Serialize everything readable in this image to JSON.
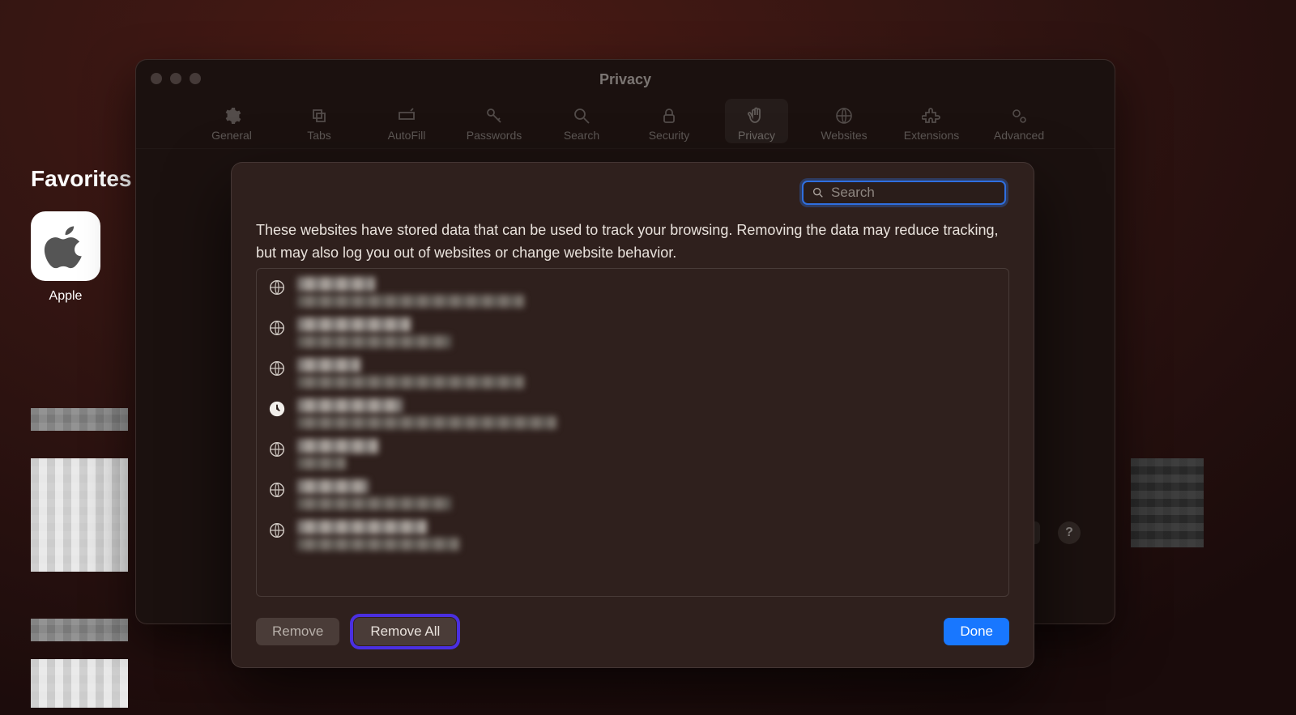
{
  "start_page": {
    "favorites_heading": "Favorites",
    "apple_label": "Apple"
  },
  "prefs": {
    "title": "Privacy",
    "tabs": [
      {
        "label": "General"
      },
      {
        "label": "Tabs"
      },
      {
        "label": "AutoFill"
      },
      {
        "label": "Passwords"
      },
      {
        "label": "Search"
      },
      {
        "label": "Security"
      },
      {
        "label": "Privacy",
        "active": true
      },
      {
        "label": "Websites"
      },
      {
        "label": "Extensions"
      },
      {
        "label": "Advanced"
      }
    ],
    "details_label": "...",
    "help_label": "?"
  },
  "sheet": {
    "search_placeholder": "Search",
    "description": "These websites have stored data that can be used to track your browsing. Removing the data may reduce tracking, but may also log you out of websites or change website behavior.",
    "rows": [
      {
        "icon": "globe",
        "w1": 96,
        "w2": 280
      },
      {
        "icon": "globe",
        "w1": 140,
        "w2": 190
      },
      {
        "icon": "globe",
        "w1": 78,
        "w2": 280
      },
      {
        "icon": "clock",
        "w1": 130,
        "w2": 320
      },
      {
        "icon": "globe",
        "w1": 100,
        "w2": 60
      },
      {
        "icon": "globe",
        "w1": 88,
        "w2": 190
      },
      {
        "icon": "globe",
        "w1": 160,
        "w2": 200
      }
    ],
    "buttons": {
      "remove": "Remove",
      "remove_all": "Remove All",
      "done": "Done"
    }
  }
}
